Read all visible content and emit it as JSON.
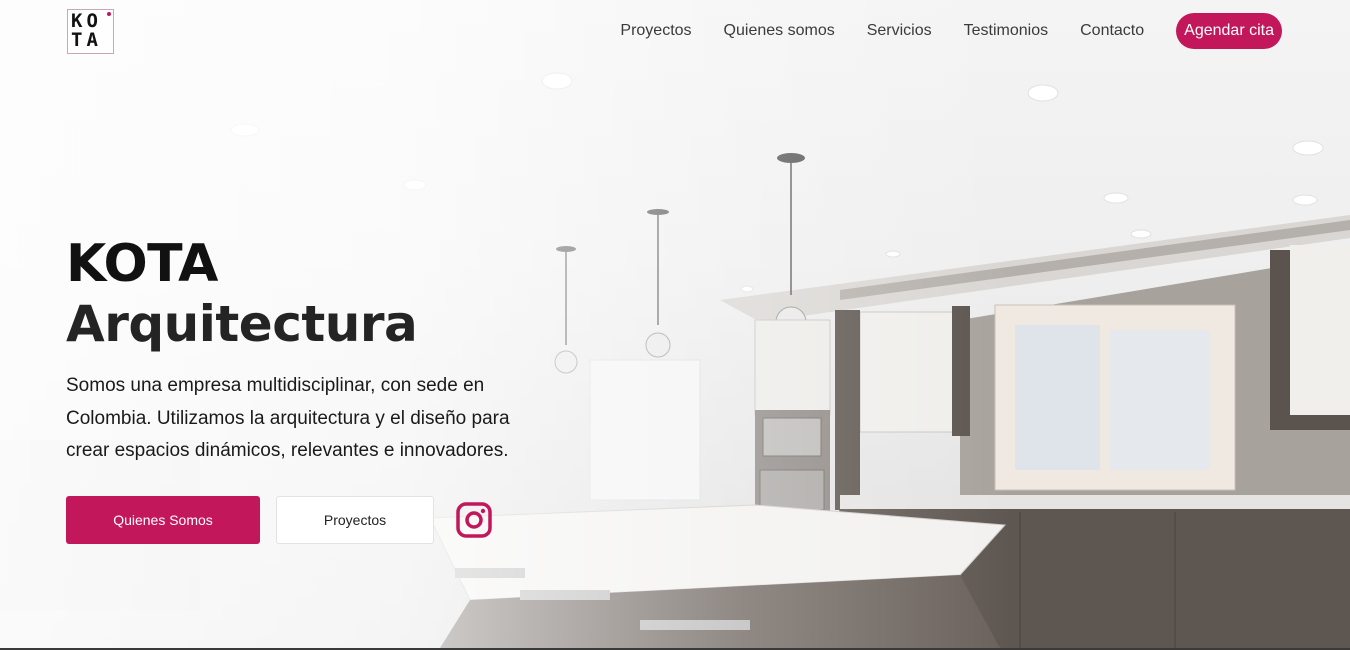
{
  "brand": {
    "logo_line1": "KO",
    "logo_line2": "TA"
  },
  "nav": {
    "items": [
      "Proyectos",
      "Quienes somos",
      "Servicios",
      "Testimonios",
      "Contacto"
    ],
    "cta_label": "Agendar cita"
  },
  "hero": {
    "title_line1": "KOTA",
    "title_line2": "Arquitectura",
    "description": "Somos una empresa multidisciplinar, con sede en Colombia. Utilizamos la arquitectura y el diseño para crear espacios dinámicos, relevantes e innovadores.",
    "primary_button": "Quienes Somos",
    "secondary_button": "Proyectos"
  },
  "icons": {
    "social": "instagram-icon"
  },
  "colors": {
    "accent": "#c2185b",
    "text": "#1f1f1f"
  }
}
